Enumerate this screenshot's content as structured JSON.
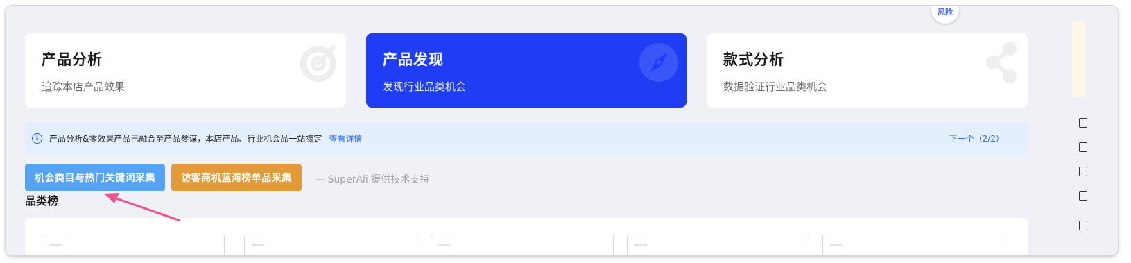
{
  "badge": "风险",
  "cards": [
    {
      "title": "产品分析",
      "subtitle": "追踪本店产品效果",
      "icon": "target-icon"
    },
    {
      "title": "产品发现",
      "subtitle": "发现行业品类机会",
      "icon": "compass-icon"
    },
    {
      "title": "款式分析",
      "subtitle": "数据验证行业品类机会",
      "icon": "share-nodes-icon"
    }
  ],
  "notice": {
    "icon": "info-icon",
    "text": "产品分析&零效果产品已融合至产品参谋，本店产品、行业机会品一站搞定",
    "link": "查看详情",
    "next": "下一个（2/2）"
  },
  "actions": {
    "collect_keywords": "机会类目与热门关键词采集",
    "collect_bluesea": "访客商机蓝海榜单品采集",
    "support": "— SuperAli 提供技术支持"
  },
  "section": {
    "title": "品类榜"
  },
  "colors": {
    "active_card": "#1f3df5",
    "button_blue": "#55a3f2",
    "button_orange": "#e39b3a",
    "arrow": "#f0508a"
  }
}
